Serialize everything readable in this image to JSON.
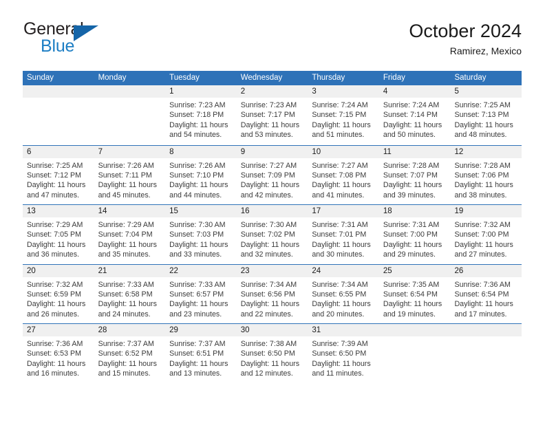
{
  "brand": {
    "name_top": "General",
    "name_bottom": "Blue",
    "triangle_icon": "triangle-icon",
    "color_top": "#231f20",
    "color_bottom": "#1d7ec4",
    "color_triangle": "#1565a8"
  },
  "header": {
    "title": "October 2024",
    "subtitle": "Ramirez, Mexico"
  },
  "theme": {
    "header_blue": "#2e72b8",
    "row_divider": "#2e72b8",
    "daynum_strip": "#f0f0f0",
    "text": "#3a3a3a"
  },
  "weekdays": [
    "Sunday",
    "Monday",
    "Tuesday",
    "Wednesday",
    "Thursday",
    "Friday",
    "Saturday"
  ],
  "weeks": [
    [
      {
        "day": ""
      },
      {
        "day": ""
      },
      {
        "day": "1",
        "sunrise": "Sunrise: 7:23 AM",
        "sunset": "Sunset: 7:18 PM",
        "daylight": "Daylight: 11 hours and 54 minutes."
      },
      {
        "day": "2",
        "sunrise": "Sunrise: 7:23 AM",
        "sunset": "Sunset: 7:17 PM",
        "daylight": "Daylight: 11 hours and 53 minutes."
      },
      {
        "day": "3",
        "sunrise": "Sunrise: 7:24 AM",
        "sunset": "Sunset: 7:15 PM",
        "daylight": "Daylight: 11 hours and 51 minutes."
      },
      {
        "day": "4",
        "sunrise": "Sunrise: 7:24 AM",
        "sunset": "Sunset: 7:14 PM",
        "daylight": "Daylight: 11 hours and 50 minutes."
      },
      {
        "day": "5",
        "sunrise": "Sunrise: 7:25 AM",
        "sunset": "Sunset: 7:13 PM",
        "daylight": "Daylight: 11 hours and 48 minutes."
      }
    ],
    [
      {
        "day": "6",
        "sunrise": "Sunrise: 7:25 AM",
        "sunset": "Sunset: 7:12 PM",
        "daylight": "Daylight: 11 hours and 47 minutes."
      },
      {
        "day": "7",
        "sunrise": "Sunrise: 7:26 AM",
        "sunset": "Sunset: 7:11 PM",
        "daylight": "Daylight: 11 hours and 45 minutes."
      },
      {
        "day": "8",
        "sunrise": "Sunrise: 7:26 AM",
        "sunset": "Sunset: 7:10 PM",
        "daylight": "Daylight: 11 hours and 44 minutes."
      },
      {
        "day": "9",
        "sunrise": "Sunrise: 7:27 AM",
        "sunset": "Sunset: 7:09 PM",
        "daylight": "Daylight: 11 hours and 42 minutes."
      },
      {
        "day": "10",
        "sunrise": "Sunrise: 7:27 AM",
        "sunset": "Sunset: 7:08 PM",
        "daylight": "Daylight: 11 hours and 41 minutes."
      },
      {
        "day": "11",
        "sunrise": "Sunrise: 7:28 AM",
        "sunset": "Sunset: 7:07 PM",
        "daylight": "Daylight: 11 hours and 39 minutes."
      },
      {
        "day": "12",
        "sunrise": "Sunrise: 7:28 AM",
        "sunset": "Sunset: 7:06 PM",
        "daylight": "Daylight: 11 hours and 38 minutes."
      }
    ],
    [
      {
        "day": "13",
        "sunrise": "Sunrise: 7:29 AM",
        "sunset": "Sunset: 7:05 PM",
        "daylight": "Daylight: 11 hours and 36 minutes."
      },
      {
        "day": "14",
        "sunrise": "Sunrise: 7:29 AM",
        "sunset": "Sunset: 7:04 PM",
        "daylight": "Daylight: 11 hours and 35 minutes."
      },
      {
        "day": "15",
        "sunrise": "Sunrise: 7:30 AM",
        "sunset": "Sunset: 7:03 PM",
        "daylight": "Daylight: 11 hours and 33 minutes."
      },
      {
        "day": "16",
        "sunrise": "Sunrise: 7:30 AM",
        "sunset": "Sunset: 7:02 PM",
        "daylight": "Daylight: 11 hours and 32 minutes."
      },
      {
        "day": "17",
        "sunrise": "Sunrise: 7:31 AM",
        "sunset": "Sunset: 7:01 PM",
        "daylight": "Daylight: 11 hours and 30 minutes."
      },
      {
        "day": "18",
        "sunrise": "Sunrise: 7:31 AM",
        "sunset": "Sunset: 7:00 PM",
        "daylight": "Daylight: 11 hours and 29 minutes."
      },
      {
        "day": "19",
        "sunrise": "Sunrise: 7:32 AM",
        "sunset": "Sunset: 7:00 PM",
        "daylight": "Daylight: 11 hours and 27 minutes."
      }
    ],
    [
      {
        "day": "20",
        "sunrise": "Sunrise: 7:32 AM",
        "sunset": "Sunset: 6:59 PM",
        "daylight": "Daylight: 11 hours and 26 minutes."
      },
      {
        "day": "21",
        "sunrise": "Sunrise: 7:33 AM",
        "sunset": "Sunset: 6:58 PM",
        "daylight": "Daylight: 11 hours and 24 minutes."
      },
      {
        "day": "22",
        "sunrise": "Sunrise: 7:33 AM",
        "sunset": "Sunset: 6:57 PM",
        "daylight": "Daylight: 11 hours and 23 minutes."
      },
      {
        "day": "23",
        "sunrise": "Sunrise: 7:34 AM",
        "sunset": "Sunset: 6:56 PM",
        "daylight": "Daylight: 11 hours and 22 minutes."
      },
      {
        "day": "24",
        "sunrise": "Sunrise: 7:34 AM",
        "sunset": "Sunset: 6:55 PM",
        "daylight": "Daylight: 11 hours and 20 minutes."
      },
      {
        "day": "25",
        "sunrise": "Sunrise: 7:35 AM",
        "sunset": "Sunset: 6:54 PM",
        "daylight": "Daylight: 11 hours and 19 minutes."
      },
      {
        "day": "26",
        "sunrise": "Sunrise: 7:36 AM",
        "sunset": "Sunset: 6:54 PM",
        "daylight": "Daylight: 11 hours and 17 minutes."
      }
    ],
    [
      {
        "day": "27",
        "sunrise": "Sunrise: 7:36 AM",
        "sunset": "Sunset: 6:53 PM",
        "daylight": "Daylight: 11 hours and 16 minutes."
      },
      {
        "day": "28",
        "sunrise": "Sunrise: 7:37 AM",
        "sunset": "Sunset: 6:52 PM",
        "daylight": "Daylight: 11 hours and 15 minutes."
      },
      {
        "day": "29",
        "sunrise": "Sunrise: 7:37 AM",
        "sunset": "Sunset: 6:51 PM",
        "daylight": "Daylight: 11 hours and 13 minutes."
      },
      {
        "day": "30",
        "sunrise": "Sunrise: 7:38 AM",
        "sunset": "Sunset: 6:50 PM",
        "daylight": "Daylight: 11 hours and 12 minutes."
      },
      {
        "day": "31",
        "sunrise": "Sunrise: 7:39 AM",
        "sunset": "Sunset: 6:50 PM",
        "daylight": "Daylight: 11 hours and 11 minutes."
      },
      {
        "day": ""
      },
      {
        "day": ""
      }
    ]
  ]
}
